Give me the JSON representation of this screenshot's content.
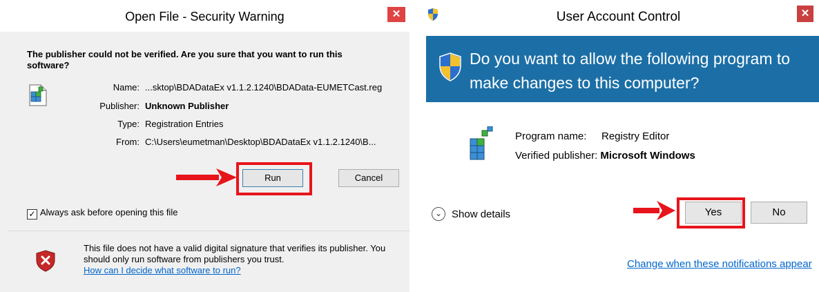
{
  "security_dialog": {
    "title": "Open File - Security Warning",
    "close_glyph": "✕",
    "question": "The publisher could not be verified. Are you sure that you want to run this software?",
    "fields": [
      {
        "label": "Name:",
        "value": "...sktop\\BDADataEx v1.1.2.1240\\BDAData-EUMETCast.reg",
        "bold": false
      },
      {
        "label": "Publisher:",
        "value": "Unknown Publisher",
        "bold": true
      },
      {
        "label": "Type:",
        "value": "Registration Entries",
        "bold": false
      },
      {
        "label": "From:",
        "value": "C:\\Users\\eumetman\\Desktop\\BDADataEx v1.1.2.1240\\B...",
        "bold": false
      }
    ],
    "run_label": "Run",
    "cancel_label": "Cancel",
    "always_ask_label": "Always ask before opening this file",
    "always_ask_checked": true,
    "warning_text": "This file does not have a valid digital signature that verifies its publisher. You should only run software from publishers you trust.",
    "warning_link": "How can I decide what software to run?"
  },
  "uac_dialog": {
    "title": "User Account Control",
    "close_glyph": "✕",
    "question": "Do you want to allow the following program to make changes to this computer?",
    "program_name_label": "Program name:",
    "program_name": "Registry Editor",
    "verified_publisher_label": "Verified publisher:",
    "verified_publisher": "Microsoft Windows",
    "show_details_label": "Show details",
    "yes_label": "Yes",
    "no_label": "No",
    "change_link": "Change when these notifications appear"
  },
  "colors": {
    "highlight_red": "#e8141b",
    "uac_banner_blue": "#1c6fa6",
    "link_blue": "#0066cc"
  }
}
